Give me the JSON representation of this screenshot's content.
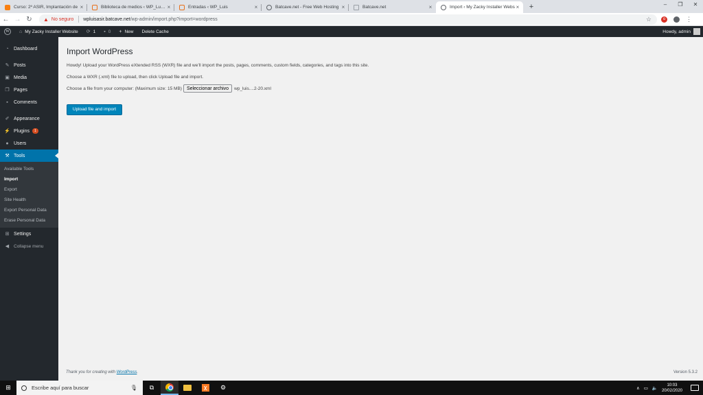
{
  "browser": {
    "tabs": [
      {
        "title": "Curso: 2º ASIR, Implantación de",
        "active": false,
        "icon": "moodle-icon"
      },
      {
        "title": "Biblioteca de medios ‹ WP_Luis –",
        "active": false,
        "icon": "wp-icon"
      },
      {
        "title": "Entradas ‹ WP_Luis",
        "active": false,
        "icon": "wp-icon"
      },
      {
        "title": "Batcave.net - Free Web Hosting",
        "active": false,
        "icon": "globe-icon"
      },
      {
        "title": "Batcave.net",
        "active": false,
        "icon": "page-icon"
      },
      {
        "title": "Import ‹ My Zacky Installer Webs",
        "active": true,
        "icon": "globe-icon"
      }
    ],
    "security_label": "No seguro",
    "url_host": "wpluisasir.batcave.net",
    "url_path": "/wp-admin/import.php?import=wordpress"
  },
  "adminbar": {
    "site_name": "My Zacky Installer Website",
    "updates_count": "1",
    "comments_count": "0",
    "new_label": "New",
    "delete_cache_label": "Delete Cache",
    "howdy": "Howdy, admin"
  },
  "sidebar": {
    "items": [
      {
        "label": "Dashboard",
        "icon": "dashboard-icon"
      },
      {
        "label": "Posts",
        "icon": "pin-icon"
      },
      {
        "label": "Media",
        "icon": "media-icon"
      },
      {
        "label": "Pages",
        "icon": "pages-icon"
      },
      {
        "label": "Comments",
        "icon": "comment-icon"
      },
      {
        "label": "Appearance",
        "icon": "brush-icon"
      },
      {
        "label": "Plugins",
        "icon": "plug-icon",
        "badge": "1"
      },
      {
        "label": "Users",
        "icon": "user-icon"
      },
      {
        "label": "Tools",
        "icon": "wrench-icon"
      }
    ],
    "tools_submenu": [
      "Available Tools",
      "Import",
      "Export",
      "Site Health",
      "Export Personal Data",
      "Erase Personal Data"
    ],
    "settings_label": "Settings",
    "collapse_label": "Collapse menu"
  },
  "main": {
    "title": "Import WordPress",
    "intro": "Howdy! Upload your WordPress eXtended RSS (WXR) file and we’ll import the posts, pages, comments, custom fields, categories, and tags into this site.",
    "instruction": "Choose a WXR (.xml) file to upload, then click Upload file and import.",
    "file_label": "Choose a file from your computer: (Maximum size: 15 MB)",
    "file_button": "Seleccionar archivo",
    "file_name": "wp_luis....2-20.xml",
    "upload_button": "Upload file and import"
  },
  "footer": {
    "thanks_prefix": "Thank you for creating with",
    "thanks_link": "WordPress",
    "thanks_suffix": ".",
    "version": "Version 5.3.2"
  },
  "taskbar": {
    "search_placeholder": "Escribe aquí para buscar",
    "time": "10:03",
    "date": "20/02/2020"
  }
}
